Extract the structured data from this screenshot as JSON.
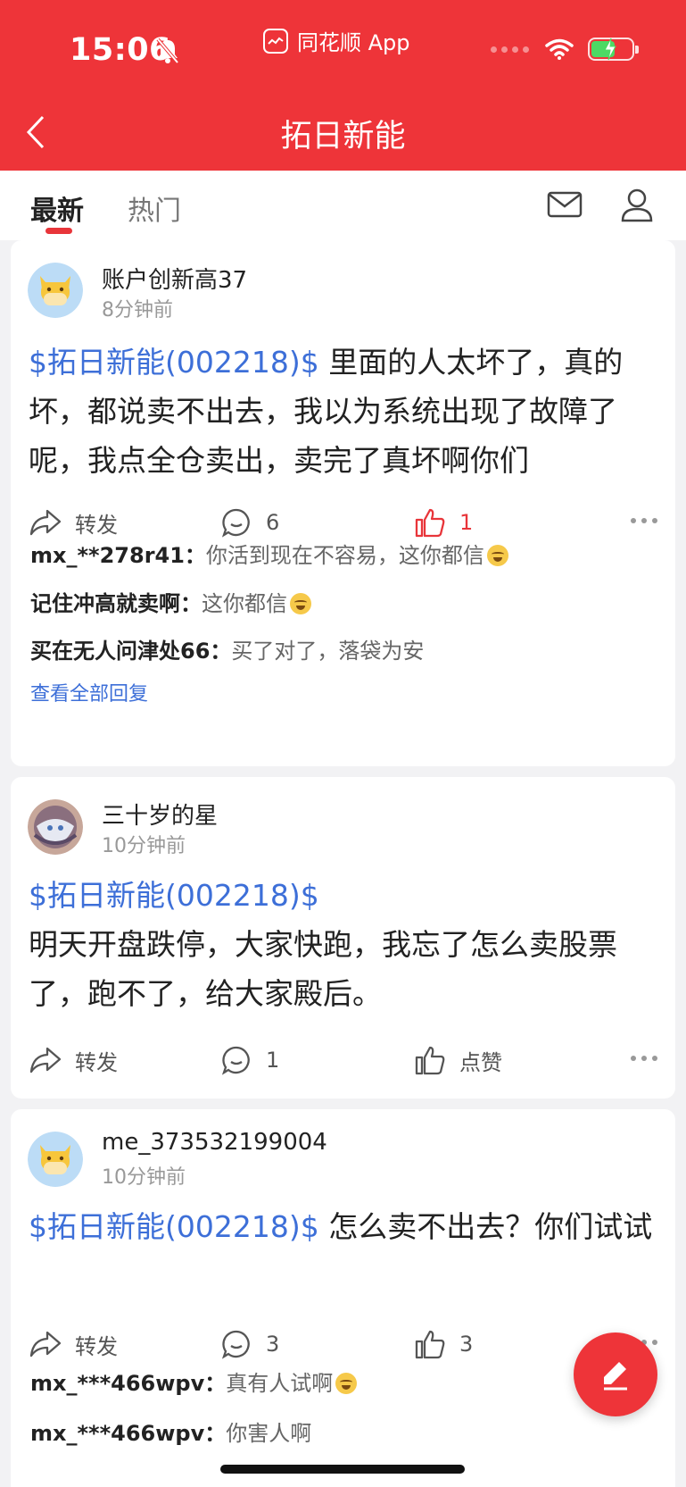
{
  "status_bar": {
    "time": "15:06",
    "app_name": "同花顺 App"
  },
  "header": {
    "title": "拓日新能"
  },
  "tabs": [
    {
      "label": "最新",
      "active": true
    },
    {
      "label": "热门",
      "active": false
    }
  ],
  "posts": [
    {
      "user": "账户创新高37",
      "time": "8分钟前",
      "stock_tag": "$拓日新能(002218)$",
      "text": " 里面的人太坏了，真的坏，都说卖不出去，我以为系统出现了故障了呢，我点全仓卖出，卖完了真坏啊你们",
      "forward_label": "转发",
      "comment_count": "6",
      "like_label": "1",
      "liked": true,
      "replies": [
        {
          "name": "mx_**278r41：",
          "text": "你活到现在不容易，这你都信",
          "emoji": "laugh-cry"
        },
        {
          "name": "记住冲高就卖啊：",
          "text": "这你都信",
          "emoji": "flushed"
        },
        {
          "name": "买在无人问津处66：",
          "text": "买了对了，落袋为安",
          "emoji": ""
        }
      ],
      "view_all": "查看全部回复"
    },
    {
      "user": "三十岁的星",
      "time": "10分钟前",
      "stock_tag": "$拓日新能(002218)$",
      "text": "明天开盘跌停，大家快跑，我忘了怎么卖股票了，跑不了，给大家殿后。",
      "forward_label": "转发",
      "comment_count": "1",
      "like_label": "点赞",
      "liked": false
    },
    {
      "user": "me_373532199004",
      "time": "10分钟前",
      "stock_tag": "$拓日新能(002218)$",
      "text": " 怎么卖不出去？你们试试",
      "forward_label": "转发",
      "comment_count": "3",
      "like_label": "3",
      "liked": false,
      "replies": [
        {
          "name": "mx_***466wpv：",
          "text": "真有人试啊",
          "emoji": "laugh-cry"
        },
        {
          "name": "mx_***466wpv：",
          "text": "你害人啊",
          "emoji": ""
        }
      ]
    }
  ],
  "colors": {
    "brand_red": "#ee3439",
    "stock_link_blue": "#3d6fd8",
    "liked_red": "#e8353a"
  },
  "icons": [
    "back-arrow-icon",
    "mail-icon",
    "profile-icon",
    "forward-icon",
    "comment-icon",
    "like-icon",
    "more-icon",
    "edit-icon"
  ]
}
